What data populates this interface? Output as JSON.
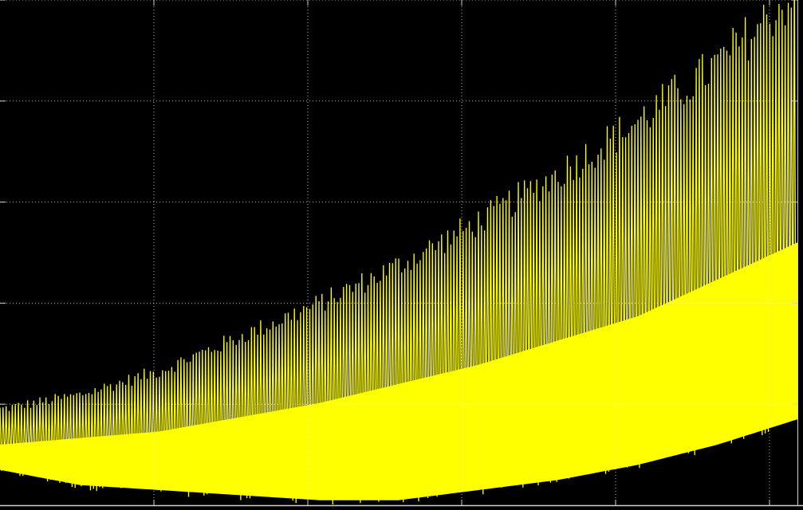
{
  "chart_data": {
    "type": "line",
    "title": "",
    "xlabel": "",
    "ylabel": "",
    "grid": true,
    "xlim": [
      0,
      1
    ],
    "ylim": [
      0,
      1
    ],
    "x_grid_values": [
      0.193,
      0.386,
      0.579,
      0.772,
      0.965
    ],
    "y_grid_values": [
      0.2,
      0.4,
      0.6,
      0.8,
      1.0
    ],
    "series": [
      {
        "values_description_note": null,
        "cycles": 260,
        "upper_envelope": {
          "x": [
            0.0,
            0.1,
            0.2,
            0.3,
            0.4,
            0.5,
            0.6,
            0.7,
            0.8,
            0.9,
            1.0
          ],
          "y": [
            0.2,
            0.23,
            0.28,
            0.35,
            0.42,
            0.5,
            0.59,
            0.69,
            0.8,
            0.92,
            1.07
          ]
        },
        "lower_envelope": {
          "x": [
            0.0,
            0.1,
            0.2,
            0.3,
            0.4,
            0.5,
            0.6,
            0.7,
            0.8,
            0.9,
            1.0
          ],
          "y": [
            0.06,
            0.03,
            0.02,
            0.01,
            0.0,
            0.0,
            0.02,
            0.04,
            0.07,
            0.11,
            0.16
          ]
        },
        "band_density_peak_y": {
          "x": [
            0.0,
            0.2,
            0.4,
            0.6,
            0.8,
            1.0
          ],
          "y": [
            0.08,
            0.09,
            0.13,
            0.19,
            0.27,
            0.4
          ]
        }
      }
    ]
  },
  "colors": {
    "background": "#000000",
    "trace": "#ffff00",
    "grid": "#ffffff",
    "border": "#d0d0d0"
  }
}
